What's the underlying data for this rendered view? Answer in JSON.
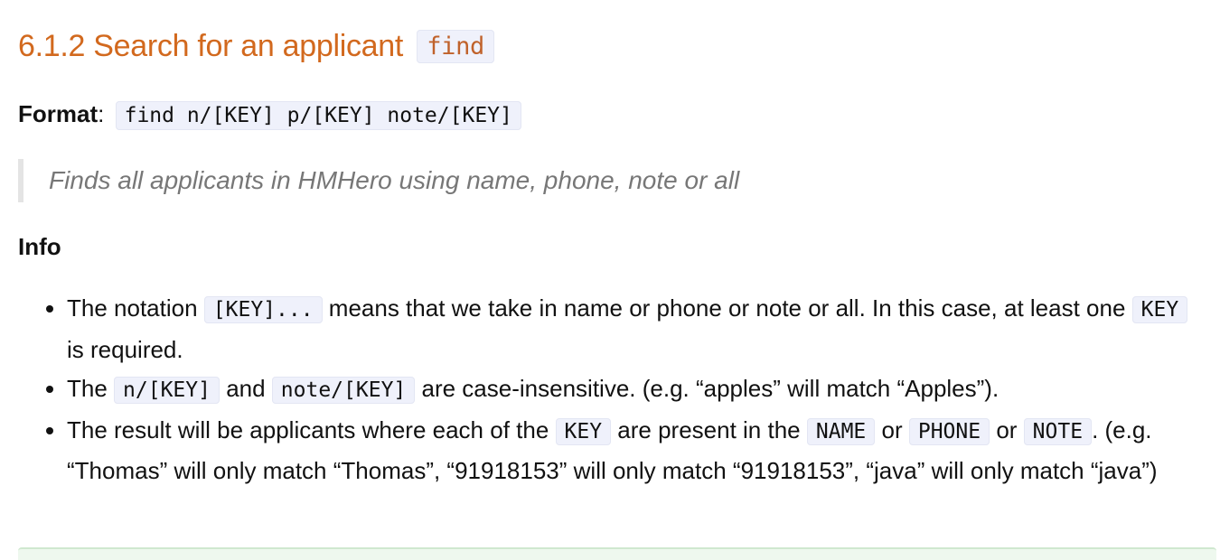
{
  "section": {
    "title": "6.1.2 Search for an applicant",
    "command": "find"
  },
  "format": {
    "label": "Format",
    "separator": ":",
    "syntax": "find n/[KEY] p/[KEY] note/[KEY]"
  },
  "description": "Finds all applicants in HMHero using name, phone, note or all",
  "info": {
    "heading": "Info",
    "items": [
      {
        "t1": "The notation ",
        "c1": "[KEY]...",
        "t2": " means that we take in name or phone or note or all. In this case, at least one ",
        "c2": "KEY",
        "t3": " is required."
      },
      {
        "t1": "The ",
        "c1": "n/[KEY]",
        "t2": " and ",
        "c2": "note/[KEY]",
        "t3": " are case-insensitive. (e.g. “apples” will match “Apples”)."
      },
      {
        "t1": "The result will be applicants where each of the ",
        "c1": "KEY",
        "t2": " are present in the ",
        "c2": "NAME",
        "t3": " or ",
        "c3": "PHONE",
        "t4": " or ",
        "c4": "NOTE",
        "t5": ". (e.g. “Thomas” will only match “Thomas”, “91918153” will only match “91918153”, “java” will only match “java”)"
      }
    ]
  },
  "colors": {
    "heading": "#d2691e",
    "code_background": "#eff1fb",
    "quote_text": "#777777",
    "quote_border": "#e4e4e4"
  }
}
